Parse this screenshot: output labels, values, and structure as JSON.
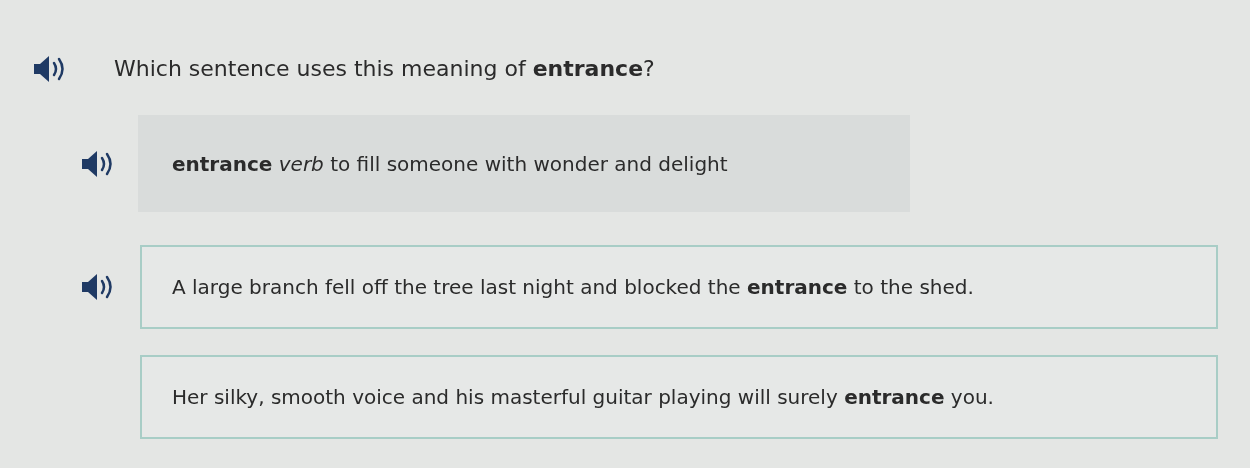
{
  "question": {
    "text": "Which sentence uses this meaning of **entrance**?",
    "audio": true
  },
  "definition": {
    "text": "**entrance** *verb* to fill someone with wonder and delight",
    "audio": true
  },
  "options": [
    {
      "text": "A large branch fell off the tree last night and blocked the **entrance** to the shed.",
      "audio": true
    },
    {
      "text": "Her silky, smooth voice and his masterful guitar playing will surely **entrance** you.",
      "audio": false
    }
  ]
}
